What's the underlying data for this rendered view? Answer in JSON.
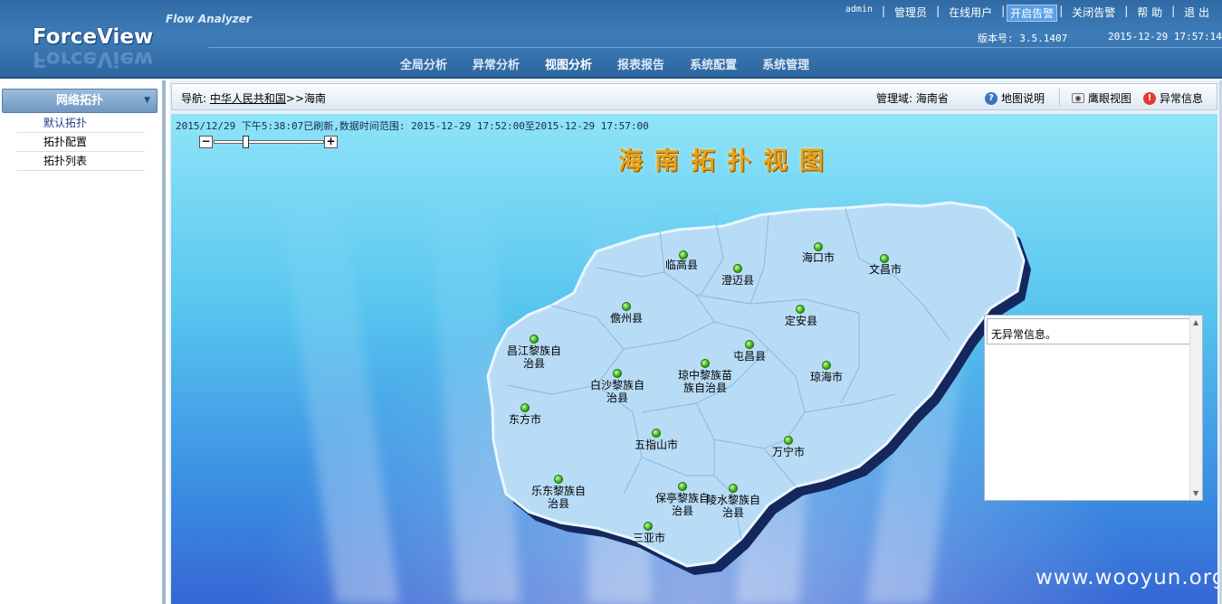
{
  "header": {
    "logo": "ForceView",
    "subtitle": "Flow Analyzer",
    "user": "admin",
    "links": [
      "管理员",
      "在线用户",
      "开启告警",
      "关闭告警",
      "帮 助",
      "退 出"
    ],
    "version": "版本号: 3.5.1407",
    "clock": "2015-12-29 17:57:14",
    "nav": [
      "全局分析",
      "异常分析",
      "视图分析",
      "报表报告",
      "系统配置",
      "系统管理"
    ]
  },
  "sidebar": {
    "title": "网络拓扑",
    "items": [
      "默认拓扑",
      "拓扑配置",
      "拓扑列表"
    ]
  },
  "crumb": {
    "label": "导航:",
    "link": "中华人民共和国",
    "rest": ">>海南"
  },
  "toolbar": {
    "domain": "管理域: 海南省",
    "help": "地图说明",
    "eagle": "鹰眼视图",
    "alert": "异常信息"
  },
  "map": {
    "refresh": "2015/12/29 下午5:38:07已刷新,数据时间范围: 2015-12-29 17:52:00至2015-12-29 17:57:00",
    "title": "海南拓扑视图",
    "cities": [
      {
        "line1": "临高县",
        "line2": ""
      },
      {
        "line1": "澄迈县",
        "line2": ""
      },
      {
        "line1": "海口市",
        "line2": ""
      },
      {
        "line1": "文昌市",
        "line2": ""
      },
      {
        "line1": "儋州县",
        "line2": ""
      },
      {
        "line1": "定安县",
        "line2": ""
      },
      {
        "line1": "昌江黎族自",
        "line2": "治县"
      },
      {
        "line1": "屯昌县",
        "line2": ""
      },
      {
        "line1": "琼中黎族苗",
        "line2": "族自治县"
      },
      {
        "line1": "白沙黎族自",
        "line2": "治县"
      },
      {
        "line1": "琼海市",
        "line2": ""
      },
      {
        "line1": "东方市",
        "line2": ""
      },
      {
        "line1": "五指山市",
        "line2": ""
      },
      {
        "line1": "万宁市",
        "line2": ""
      },
      {
        "line1": "乐东黎族自",
        "line2": "治县"
      },
      {
        "line1": "保亭黎族自",
        "line2": "治县"
      },
      {
        "line1": "陵水黎族自",
        "line2": "治县"
      },
      {
        "line1": "三亚市",
        "line2": ""
      }
    ],
    "status_color": "#3ab51a"
  },
  "alerts": {
    "message": "无异常信息。"
  },
  "watermark": "www.wooyun.org"
}
